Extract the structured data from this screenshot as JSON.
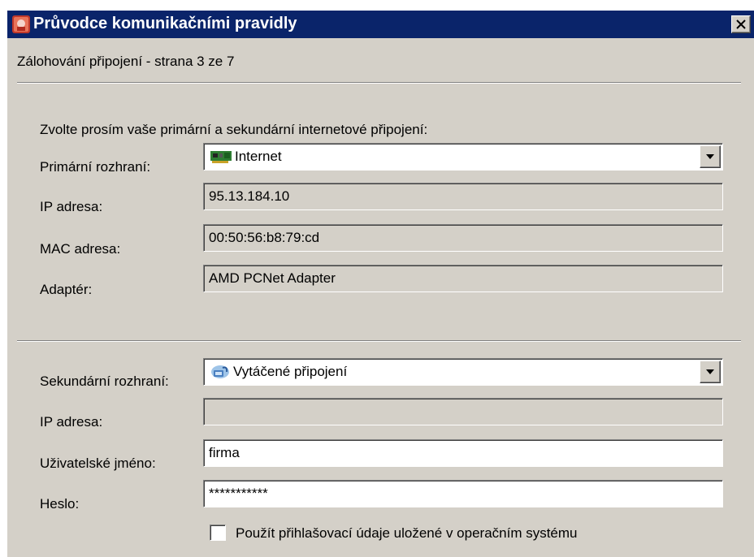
{
  "window": {
    "title": "Průvodce komunikačními pravidly",
    "close_label": "✕"
  },
  "page": {
    "heading": "Zálohování připojení - strana 3 ze 7",
    "instruction": "Zvolte prosím vaše primární a sekundární internetové připojení:"
  },
  "primary": {
    "interface_label": "Primární rozhraní:",
    "interface_value": "Internet",
    "interface_icon": "network-card-icon",
    "ip_label": "IP adresa:",
    "ip_value": "95.13.184.10",
    "mac_label": "MAC adresa:",
    "mac_value": "00:50:56:b8:79:cd",
    "adapter_label": "Adaptér:",
    "adapter_value": "AMD PCNet Adapter"
  },
  "secondary": {
    "interface_label": "Sekundární rozhraní:",
    "interface_value": "Vytáčené připojení",
    "interface_icon": "dialup-connection-icon",
    "ip_label": "IP adresa:",
    "ip_value": "",
    "username_label": "Uživatelské jméno:",
    "username_value": "firma",
    "password_label": "Heslo:",
    "password_value": "***********",
    "use_os_credentials_label": "Použít přihlašovací údaje uložené v operačním systému",
    "use_os_credentials_checked": false
  },
  "colors": {
    "titlebar": "#0a246a",
    "dialog_bg": "#d4d0c8"
  }
}
